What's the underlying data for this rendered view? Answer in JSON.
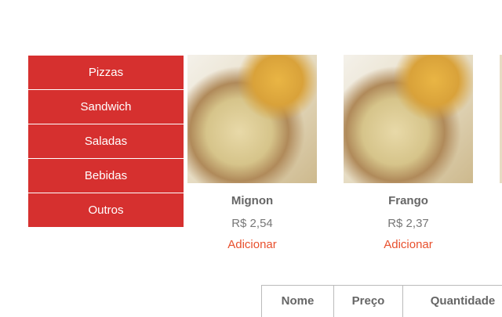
{
  "menu": {
    "items": [
      {
        "label": "Pizzas"
      },
      {
        "label": "Sandwich"
      },
      {
        "label": "Saladas"
      },
      {
        "label": "Bebidas"
      },
      {
        "label": "Outros"
      }
    ]
  },
  "products": [
    {
      "name": "Mignon",
      "price": "R$ 2,54",
      "action": "Adicionar"
    },
    {
      "name": "Frango",
      "price": "R$ 2,37",
      "action": "Adicionar"
    }
  ],
  "table": {
    "headers": [
      "Nome",
      "Preço",
      "Quantidade"
    ]
  },
  "colors": {
    "menu_bg": "#d6302f",
    "action": "#e8502d"
  }
}
